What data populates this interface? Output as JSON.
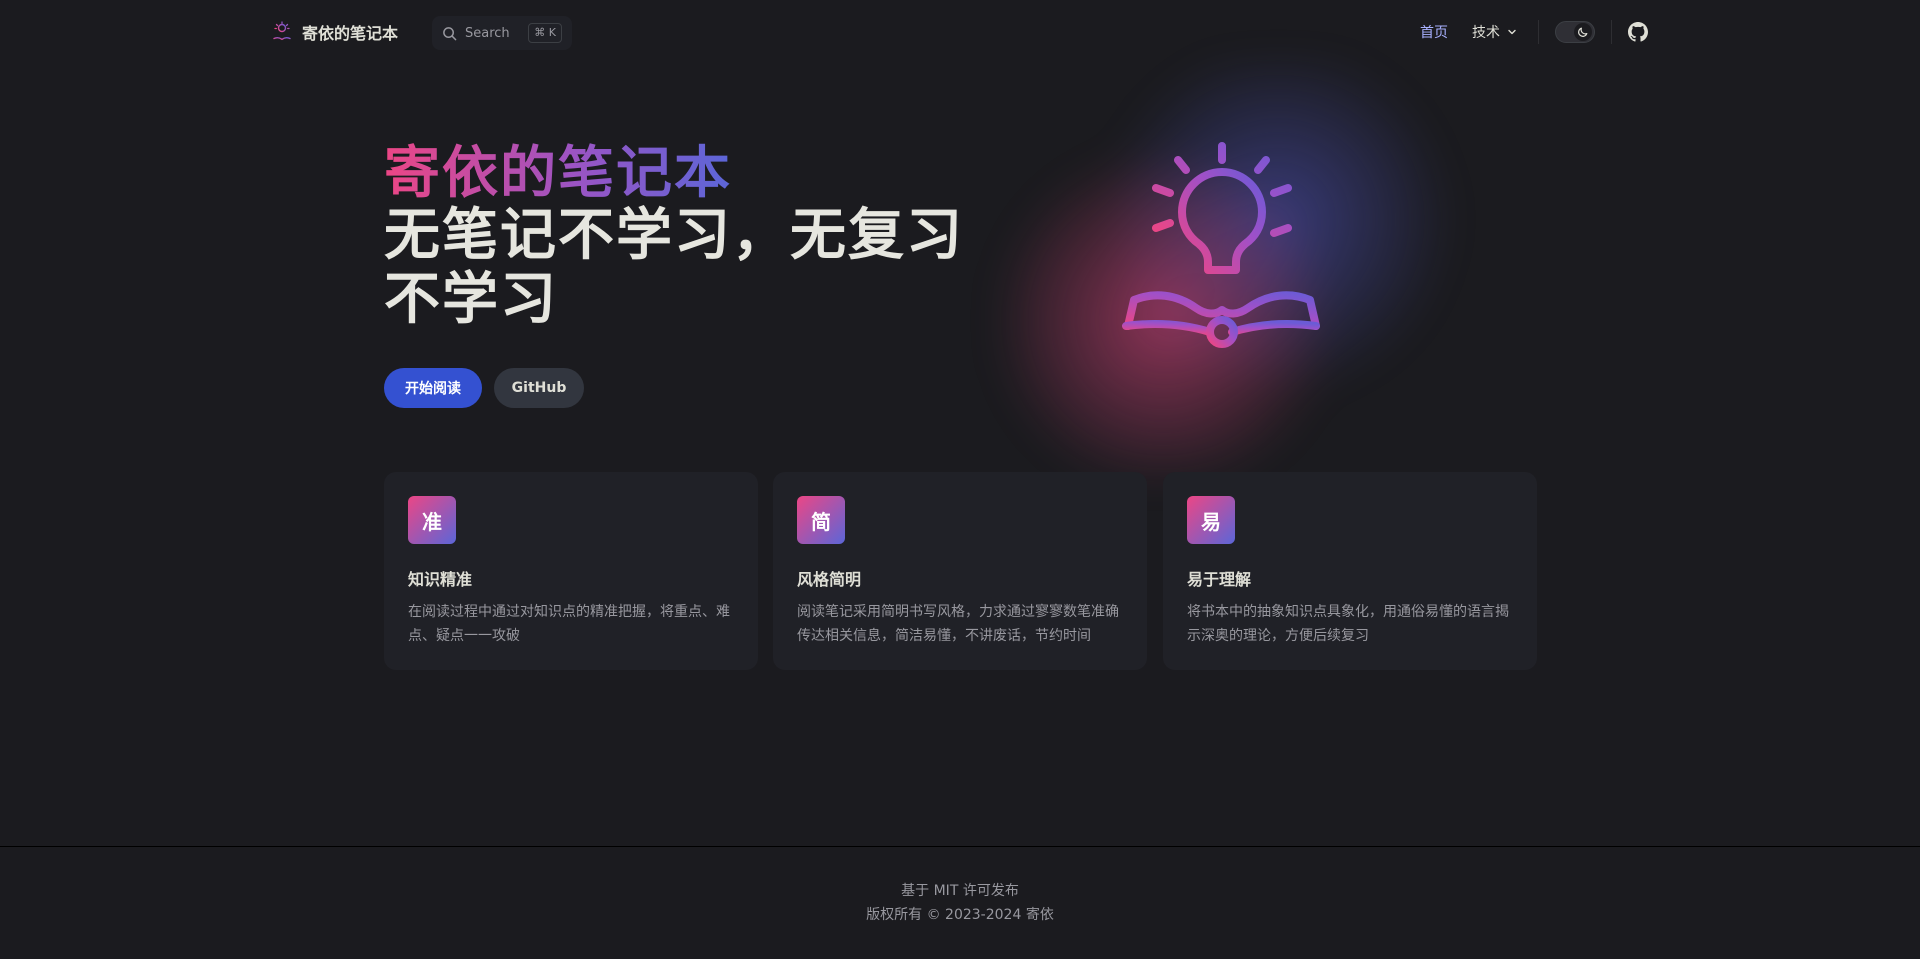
{
  "nav": {
    "title": "寄依的笔记本",
    "search_label": "Search",
    "search_shortcut": "⌘ K",
    "home_label": "首页",
    "tech_label": "技术",
    "logo_icon": "reading-lightbulb-icon",
    "search_icon": "search-icon",
    "theme_icon": "moon-icon",
    "github_icon": "github-icon",
    "active_color": "#a8b1ff"
  },
  "hero": {
    "name": "寄依的笔记本",
    "text": "无笔记不学习，无复习不学习",
    "primary_action": "开始阅读",
    "secondary_action": "GitHub",
    "image_icon": "lightbulb-book-icon",
    "gradient_start": "#ec4685",
    "gradient_end": "#5b66d8",
    "primary_color": "#3451d1"
  },
  "features": [
    {
      "icon": "准",
      "title": "知识精准",
      "details": "在阅读过程中通过对知识点的精准把握，将重点、难点、疑点一一攻破"
    },
    {
      "icon": "简",
      "title": "风格简明",
      "details": "阅读笔记采用简明书写风格，力求通过寥寥数笔准确传达相关信息，简洁易懂，不讲废话，节约时间"
    },
    {
      "icon": "易",
      "title": "易于理解",
      "details": "将书本中的抽象知识点具象化，用通俗易懂的语言揭示深奥的理论，方便后续复习"
    }
  ],
  "footer": {
    "message": "基于 MIT 许可发布",
    "copyright": "版权所有 © 2023-2024 寄依"
  }
}
